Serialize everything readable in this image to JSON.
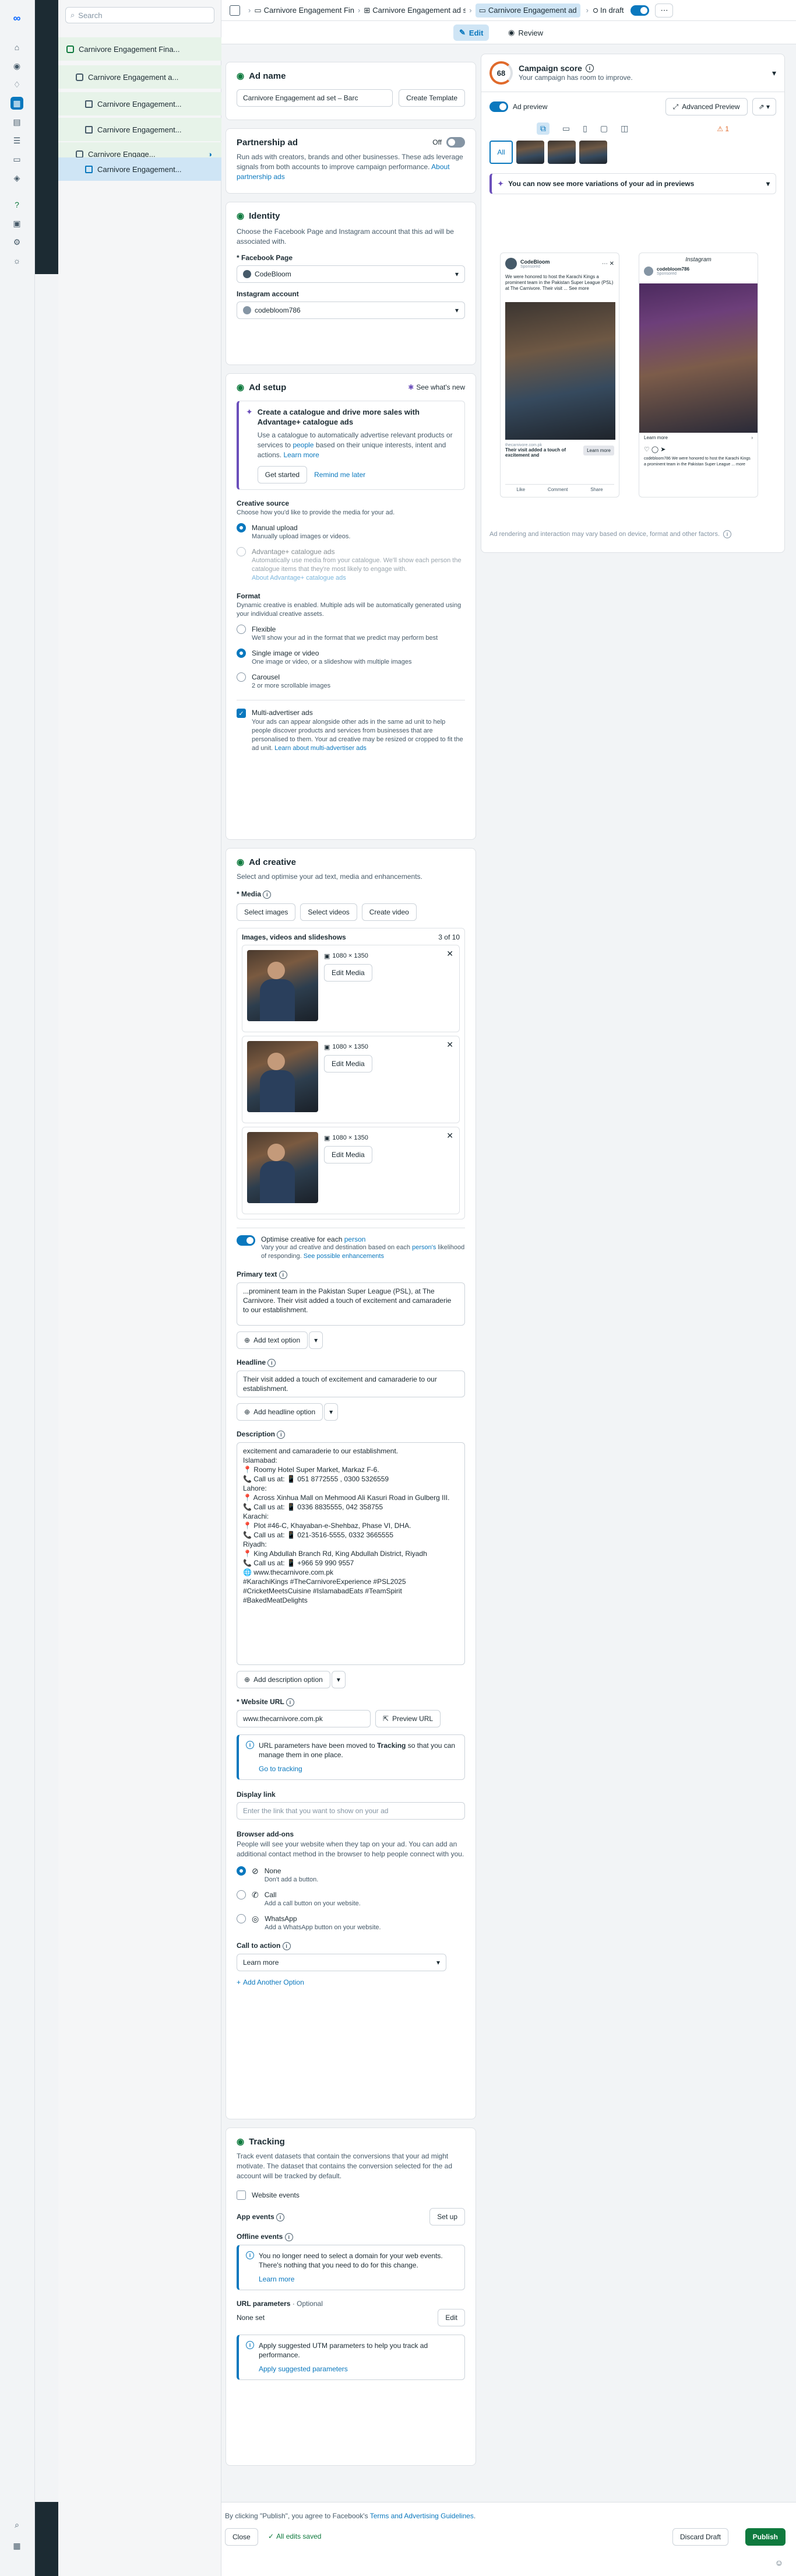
{
  "search": {
    "placeholder": "Search"
  },
  "tree": {
    "items": [
      {
        "label": "Carnivore Engagement Fina..."
      },
      {
        "label": "Carnivore Engagement a..."
      },
      {
        "label": "Carnivore Engagement..."
      },
      {
        "label": "Carnivore Engagement..."
      },
      {
        "label": "Carnivore Engage..."
      },
      {
        "label": "Carnivore Engagement..."
      }
    ]
  },
  "topbar": {
    "crumb1": "Carnivore Engagement Fin",
    "crumb2": "Carnivore Engagement ad s",
    "crumb3": "Carnivore Engagement ad",
    "status": "In draft"
  },
  "tabs": {
    "edit": "Edit",
    "review": "Review"
  },
  "ad_name": {
    "title": "Ad name",
    "value": "Carnivore Engagement ad set – Barc",
    "template_btn": "Create Template"
  },
  "partnership": {
    "title": "Partnership ad",
    "toggle_label": "Off",
    "desc": "Run ads with creators, brands and other businesses. These ads leverage signals from both accounts to improve campaign performance.",
    "link": "About partnership ads"
  },
  "identity": {
    "title": "Identity",
    "desc": "Choose the Facebook Page and Instagram account that this ad will be associated with.",
    "page_label": "* Facebook Page",
    "page_value": "CodeBloom",
    "ig_label": "Instagram account",
    "ig_value": "codebloom786"
  },
  "ad_setup": {
    "title": "Ad setup",
    "whats_new": "See what's new",
    "catalogue_title": "Create a catalogue and drive more sales with Advantage+ catalogue ads",
    "catalogue_desc": "Use a catalogue to automatically advertise relevant products or services to",
    "catalogue_desc_link": "people",
    "catalogue_desc2": "based on their unique interests, intent and actions.",
    "learn_more": "Learn more",
    "get_started": "Get started",
    "remind_later": "Remind me later",
    "creative_source_label": "Creative source",
    "creative_source_desc": "Choose how you'd like to provide the media for your ad.",
    "manual_title": "Manual upload",
    "manual_desc": "Manually upload images or videos.",
    "adv_title": "Advantage+ catalogue ads",
    "adv_desc": "Automatically use media from your catalogue. We'll show each person the catalogue items that they're most likely to engage with.",
    "adv_link": "About Advantage+ catalogue ads",
    "format_label": "Format",
    "format_desc": "Dynamic creative is enabled. Multiple ads will be automatically generated using your individual creative assets.",
    "flexible_title": "Flexible",
    "flexible_desc": "We'll show your ad in the format that we predict may perform best",
    "single_title": "Single image or video",
    "single_desc": "One image or video, or a slideshow with multiple images",
    "carousel_title": "Carousel",
    "carousel_desc": "2 or more scrollable images",
    "multi_title": "Multi-advertiser ads",
    "multi_desc": "Your ads can appear alongside other ads in the same ad unit to help people discover products and services from businesses that are personalised to them. Your ad creative may be resized or cropped to fit the ad unit.",
    "multi_link": "Learn about multi-advertiser ads"
  },
  "ad_creative": {
    "title": "Ad creative",
    "desc": "Select and optimise your ad text, media and enhancements.",
    "media_label": "* Media",
    "select_images": "Select images",
    "select_videos": "Select videos",
    "create_video": "Create video",
    "list_title": "Images, videos and slideshows",
    "count": "3 of 10",
    "items": [
      {
        "size": "1080 × 1350",
        "edit": "Edit Media"
      },
      {
        "size": "1080 × 1350",
        "edit": "Edit Media"
      },
      {
        "size": "1080 × 1350",
        "edit": "Edit Media"
      }
    ],
    "optimise_title": "Optimise creative for each",
    "optimise_link": "person",
    "optimise_desc": "Vary your ad creative and destination based on each",
    "optimise_desc_link": "person's",
    "optimise_desc2": "likelihood of responding.",
    "optimise_desc_link2": "See possible enhancements",
    "primary_label": "Primary text",
    "primary_text": "...prominent team in the Pakistan Super League (PSL), at The Carnivore. Their visit added a touch of excitement and camaraderie to our establishment.",
    "add_text_option": "Add text option",
    "headline_label": "Headline",
    "headline_text": "Their visit added a touch of excitement and camaraderie to our establishment.",
    "add_headline_option": "Add headline option",
    "description_label": "Description",
    "description_lines": [
      "excitement and camaraderie to our establishment.",
      "Islamabad:",
      "📍 Roomy Hotel Super Market, Markaz F-6.",
      "📞 Call us at: 📱 051 8772555 , 0300 5326559",
      "Lahore:",
      "📍 Across Xinhua Mall on Mehmood Ali Kasuri Road in Gulberg III.",
      "📞 Call us at: 📱 0336 8835555, 042 358755",
      "Karachi:",
      "📍 Plot #46-C, Khayaban-e-Shehbaz, Phase VI, DHA.",
      "📞 Call us at: 📱 021-3516-5555, 0332 3665555",
      "Riyadh:",
      "📍 King Abdullah Branch Rd, King Abdullah District, Riyadh",
      "📞 Call us at: 📱 +966 59 990 9557",
      "🌐 www.thecarnivore.com.pk",
      "#KarachiKings #TheCarnivoreExperience #PSL2025 #CricketMeetsCuisine #IslamabadEats #TeamSpirit #BakedMeatDelights"
    ],
    "add_description_option": "Add description option",
    "url_label": "* Website URL",
    "url_value": "www.thecarnivore.com.pk",
    "preview_url": "Preview URL",
    "url_info": "URL parameters have been moved to",
    "url_info_bold": "Tracking",
    "url_info2": "so that you can manage them in one place.",
    "go_tracking": "Go to tracking",
    "display_link_label": "Display link",
    "display_link_placeholder": "Enter the link that you want to show on your ad",
    "browser_label": "Browser add-ons",
    "browser_desc": "People will see your website when they tap on your ad. You can add an additional contact method in the browser to help people connect with you.",
    "none_title": "None",
    "none_desc": "Don't add a button.",
    "call_title": "Call",
    "call_desc": "Add a call button on your website.",
    "whatsapp_title": "WhatsApp",
    "whatsapp_desc": "Add a WhatsApp button on your website.",
    "cta_label": "Call to action",
    "cta_value": "Learn more",
    "add_another": "Add Another Option"
  },
  "tracking": {
    "title": "Tracking",
    "desc": "Track event datasets that contain the conversions that your ad might motivate. The dataset that contains the conversion selected for the ad account will be tracked by default.",
    "website_events": "Website events",
    "app_events": "App events",
    "setup": "Set up",
    "offline_events": "Offline events",
    "domain_info": "You no longer need to select a domain for your web events. There's nothing that you need to do for this change.",
    "learn_more": "Learn more",
    "url_params_label": "URL parameters",
    "url_params_optional": "· Optional",
    "url_params_value": "None set",
    "edit": "Edit",
    "utm_info": "Apply suggested UTM parameters to help you track ad performance.",
    "apply_utm": "Apply suggested parameters"
  },
  "preview": {
    "score_value": "68",
    "score_title": "Campaign score",
    "score_desc": "Your campaign has room to improve.",
    "ad_preview": "Ad preview",
    "advanced_preview": "Advanced Preview",
    "all_tab": "All",
    "warn_count": "1",
    "variations_banner": "You can now see more variations of your ad in previews",
    "fb_page": "CodeBloom",
    "fb_sponsored": "Sponsored",
    "fb_text": "We were honored to host the Karachi Kings a prominent team in the Pakistan Super League (PSL) at The Carnivore. Their visit ... See more",
    "fb_domain": "thecarnivore.com.pk",
    "fb_headline": "Their visit added a touch of excitement and",
    "fb_cta": "Learn more",
    "fb_like": "Like",
    "fb_comment": "Comment",
    "fb_share": "Share",
    "ig_brand": "Instagram",
    "ig_user": "codebloom786",
    "ig_sponsored": "Sponsored",
    "ig_cta": "Learn more",
    "ig_caption": "codebloom786 We were honored to host the Karachi Kings a prominent team in the Pakistan Super League ... more",
    "disclaimer": "Ad rendering and interaction may vary based on device, format and other factors."
  },
  "footer": {
    "terms_prefix": "By clicking \"Publish\", you agree to Facebook's",
    "terms_link": "Terms and Advertising Guidelines",
    "close": "Close",
    "saved": "All edits saved",
    "discard": "Discard Draft",
    "publish": "Publish"
  },
  "colors": {
    "accent": "#0a78be",
    "publish": "#0f7a3e",
    "score": "#e06a2b"
  }
}
